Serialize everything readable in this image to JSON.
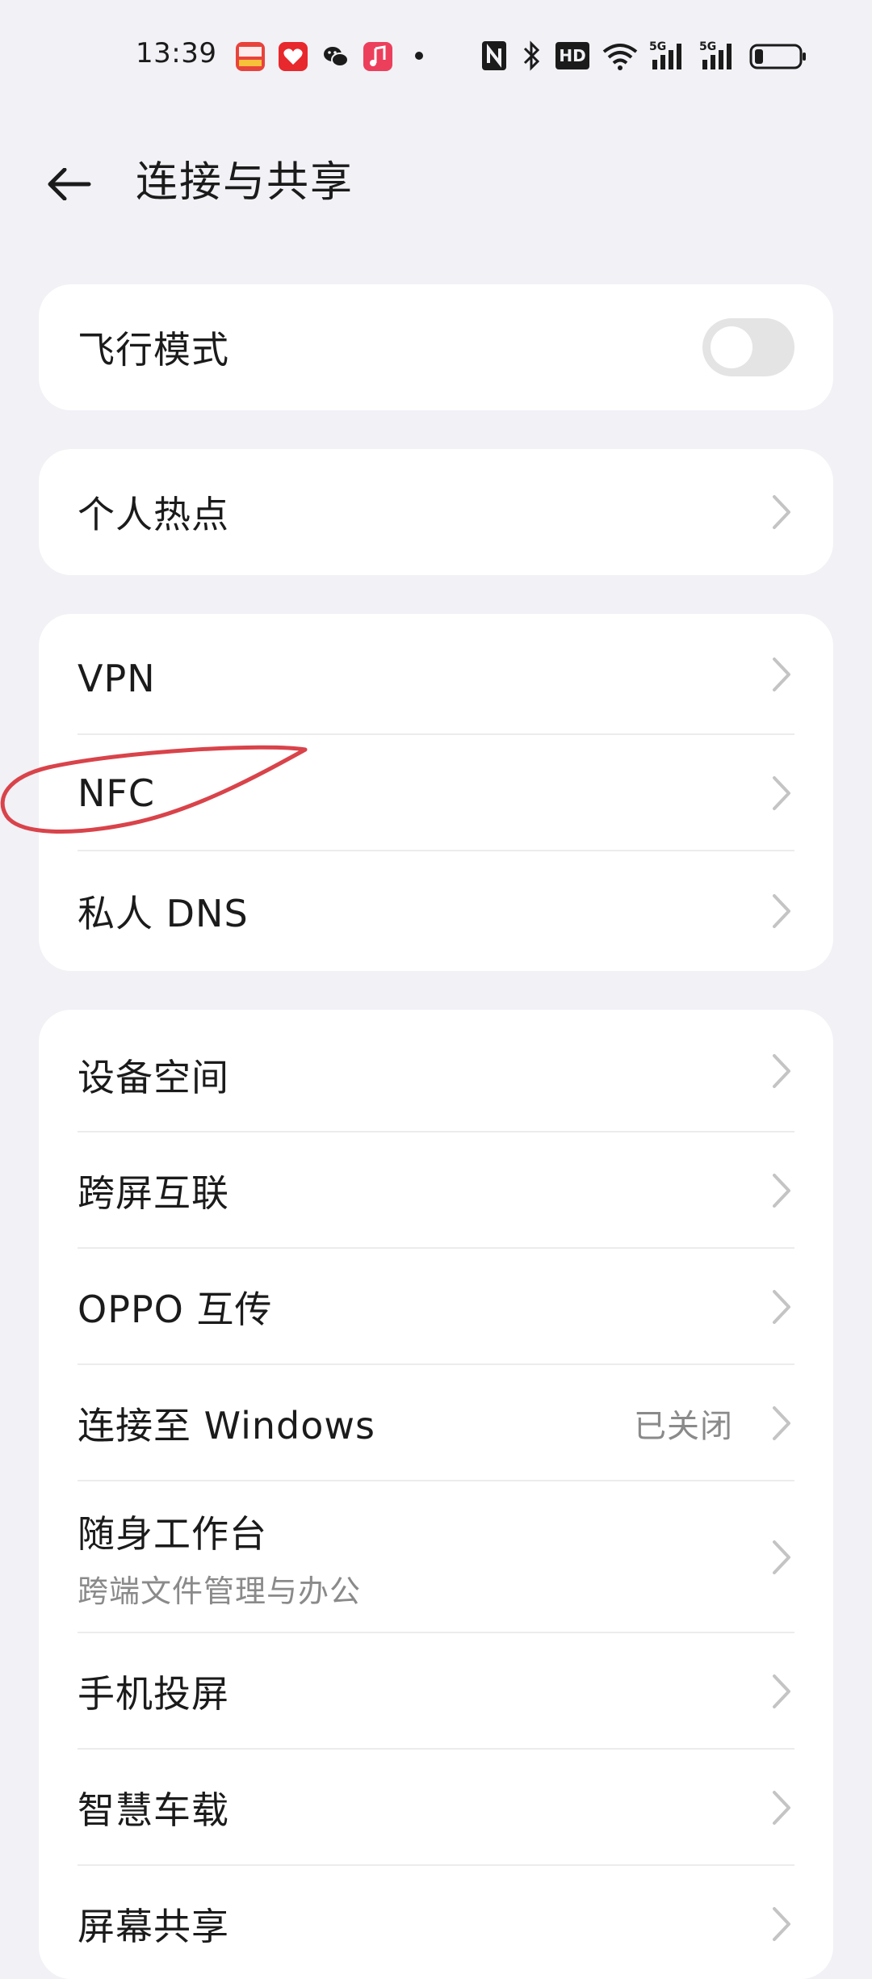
{
  "status_bar": {
    "time": "13:39",
    "notification_icons": [
      "toutiao-icon",
      "taobao-icon",
      "wechat-icon",
      "music-icon"
    ],
    "system_icons": [
      "nfc-icon",
      "bluetooth-icon",
      "hd-icon",
      "wifi-icon",
      "signal-5g-icon",
      "signal-5g-icon",
      "battery-icon"
    ],
    "hd_label": "HD",
    "signal_label": "5G"
  },
  "header": {
    "title": "连接与共享"
  },
  "airplane_card": {
    "label": "飞行模式",
    "toggle_on": false
  },
  "hotspot_card": {
    "label": "个人热点"
  },
  "network_card": {
    "items": [
      {
        "label": "VPN"
      },
      {
        "label": "NFC"
      },
      {
        "label": "私人 DNS"
      }
    ]
  },
  "devices_card": {
    "items": [
      {
        "label": "设备空间"
      },
      {
        "label": "跨屏互联"
      },
      {
        "label": "OPPO 互传"
      },
      {
        "label": "连接至 Windows",
        "value": "已关闭"
      },
      {
        "label": "随身工作台",
        "sub": "跨端文件管理与办公"
      },
      {
        "label": "手机投屏"
      },
      {
        "label": "智慧车载"
      },
      {
        "label": "屏幕共享"
      }
    ]
  },
  "colors": {
    "background": "#f1f1f6",
    "card": "#ffffff",
    "annotation": "#d9434a",
    "secondary_text": "#8a8a8a"
  }
}
